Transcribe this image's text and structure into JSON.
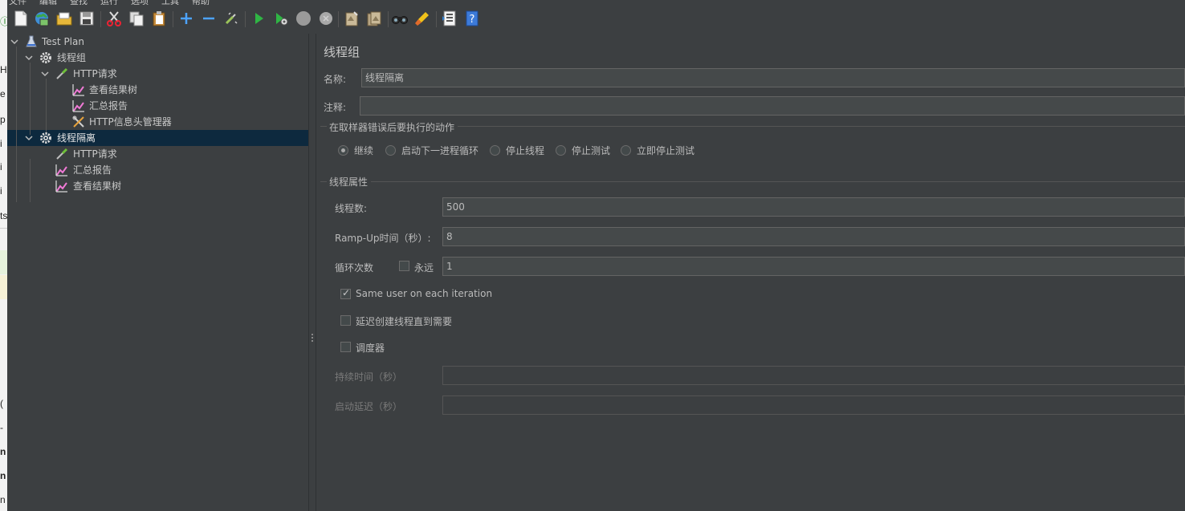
{
  "tree": {
    "test_plan": "Test Plan",
    "group1": "线程组",
    "group1_http": "HTTP请求",
    "group1_tree_listener": "查看结果树",
    "group1_summary": "汇总报告",
    "group1_header_mgr": "HTTP信息头管理器",
    "group2": "线程隔离",
    "group2_http": "HTTP请求",
    "group2_summary": "汇总报告",
    "group2_tree_listener": "查看结果树"
  },
  "panel": {
    "title": "线程组",
    "name_label": "名称:",
    "name_value": "线程隔离",
    "comment_label": "注释:",
    "comment_value": "",
    "error_section": "在取样器错误后要执行的动作",
    "error_options": [
      "继续",
      "启动下一进程循环",
      "停止线程",
      "停止测试",
      "立即停止测试"
    ],
    "error_selected": "继续",
    "props_section": "线程属性",
    "threads_label": "线程数:",
    "threads_value": "500",
    "rampup_label": "Ramp-Up时间（秒）:",
    "rampup_value": "8",
    "loop_label": "循环次数",
    "forever_label": "永远",
    "loop_value": "1",
    "same_user_label": "Same user on each iteration",
    "delay_label": "延迟创建线程直到需要",
    "scheduler_label": "调度器",
    "duration_label": "持续时间（秒）",
    "duration_value": "",
    "startup_label": "启动延迟（秒）",
    "startup_value": ""
  },
  "state": {
    "forever_checked": false,
    "same_user_checked": true,
    "delay_checked": false,
    "scheduler_checked": false
  },
  "menu": [
    "文件",
    "编辑",
    "查找",
    "运行",
    "选项",
    "工具",
    "帮助"
  ],
  "sliver_glyphs": [
    "Ⓘ",
    "H",
    "e",
    "p",
    "i",
    "i",
    "i",
    "ts",
    "(",
    "-",
    "n",
    "n",
    "n"
  ],
  "colors": {
    "background": "#3c3f41",
    "field": "#45494a",
    "selection": "#0d293e",
    "text": "#bbbbbb"
  },
  "icons": [
    "new-icon",
    "templates-icon",
    "open-icon",
    "save-icon",
    "cut-icon",
    "copy-icon",
    "paste-icon",
    "expand-icon",
    "collapse-icon",
    "toggle-icon",
    "start-icon",
    "start-no-pause-icon",
    "stop-icon",
    "shutdown-icon",
    "clear-icon",
    "clear-all-icon",
    "search-icon",
    "reset-search-icon",
    "function-helper-icon",
    "help-icon"
  ]
}
